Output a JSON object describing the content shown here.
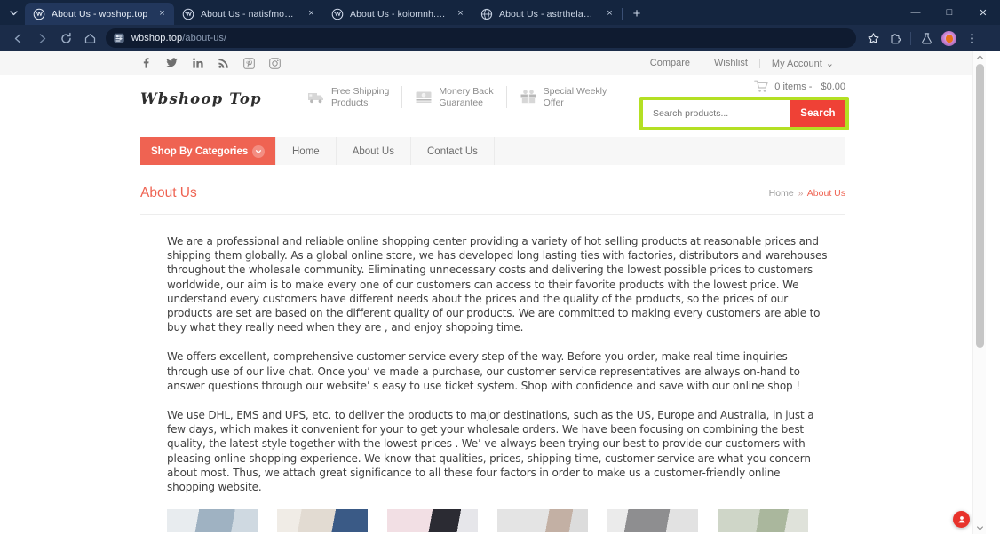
{
  "browser": {
    "tabs": [
      {
        "title": "About Us - wbshop.top",
        "favicon": "wordpress-icon",
        "active": true
      },
      {
        "title": "About Us - natisfmoneop.top",
        "favicon": "wordpress-icon",
        "active": false
      },
      {
        "title": "About Us - koiomnh.top",
        "favicon": "wordpress-icon",
        "active": false
      },
      {
        "title": "About Us - astrthelab.shop",
        "favicon": "globe-icon",
        "active": false
      }
    ],
    "tab_close_label": "×",
    "new_tab_label": "+",
    "tab_search_name": "tab-search-chevron-icon",
    "window_controls": {
      "minimize": "—",
      "maximize": "□",
      "close": "✕"
    },
    "nav": {
      "back": "←",
      "forward": "→",
      "reload": "⟳",
      "home": "⌂"
    },
    "omnibox": {
      "url_host": "wbshop.top",
      "url_path": "/about-us/",
      "site_icon": "page-settings-icon"
    },
    "toolbar_icons": [
      "bookmark-star-icon",
      "extensions-puzzle-icon",
      "labs-flask-icon",
      "profile-avatar",
      "chrome-menu-icon"
    ]
  },
  "site": {
    "socials": [
      {
        "name": "facebook-icon",
        "glyph": "f"
      },
      {
        "name": "twitter-icon",
        "glyph": "🐦"
      },
      {
        "name": "linkedin-icon",
        "glyph": "in"
      },
      {
        "name": "rss-icon",
        "glyph": "◔"
      },
      {
        "name": "pinterest-icon",
        "glyph": "ⓟ"
      },
      {
        "name": "instagram-icon",
        "glyph": "▣"
      }
    ],
    "util_links": [
      "Compare",
      "Wishlist",
      "My Account"
    ],
    "my_account_caret": "⌄",
    "logo": "Wbshoop Top",
    "features": [
      {
        "icon": "delivery-truck-icon",
        "line1": "Free Shipping",
        "line2": "Products"
      },
      {
        "icon": "money-back-icon",
        "line1": "Monery Back",
        "line2": "Guarantee"
      },
      {
        "icon": "gift-offer-icon",
        "line1": "Special Weekly",
        "line2": "Offer"
      }
    ],
    "cart": {
      "icon": "shopping-cart-icon",
      "items_text": "0 items -",
      "total": "$0.00"
    },
    "search": {
      "placeholder": "Search products...",
      "value": "",
      "button_label": "Search",
      "highlight_color": "#b4e023"
    },
    "nav": {
      "categories_label": "Shop By Categories",
      "categories_caret": "❯",
      "links": [
        "Home",
        "About Us",
        "Contact Us"
      ]
    },
    "page_title": "About Us",
    "breadcrumb": {
      "home": "Home",
      "separator": "»",
      "current": "About Us"
    },
    "paragraphs": [
      "We are a professional and reliable online shopping center providing a variety of hot selling products at reasonable prices and shipping them globally. As a global online store, we has developed long lasting ties with factories, distributors and warehouses throughout the wholesale community. Eliminating unnecessary costs and delivering the lowest possible prices to customers worldwide, our aim is to make every one of our customers can access to their favorite products with the lowest price. We understand every customers have different needs about the prices and the quality of the products, so the prices of our products are set are based on the different quality of our products. We are committed to making every customers are able to buy what they really need when they are , and enjoy shopping time.",
      "We offers excellent, comprehensive customer service every step of the way. Before you order, make real time inquiries through use of our live chat. Once you’ ve made a purchase, our customer service representatives are always on-hand to answer questions through our website’ s easy to use ticket system. Shop with confidence and save with  our online shop !",
      "We use DHL, EMS and UPS, etc. to deliver the products to major destinations, such as the US, Europe and Australia, in just a few days, which makes it convenient for your to get your wholesale orders. We have been focusing on combining the best quality, the latest style together with the lowest prices . We’ ve always been trying our best to provide our customers with pleasing online shopping experience. We know that qualities, prices, shipping time, customer service are what you concern about most. Thus, we attach great significance to all these four factors in order to make us a customer-friendly online shopping website."
    ],
    "product_thumbs": [
      {
        "name": "product-thumb-1",
        "color_a": "#e8ecef",
        "color_b": "#8fa3b4"
      },
      {
        "name": "product-thumb-2",
        "color_a": "#efe9e2",
        "color_b": "#3a5a86"
      },
      {
        "name": "product-thumb-3",
        "color_a": "#f2dfe4",
        "color_b": "#2b2b33"
      },
      {
        "name": "product-thumb-4",
        "color_a": "#e4e4e4",
        "color_b": "#b9a79c"
      },
      {
        "name": "product-thumb-5",
        "color_a": "#e9e9e9",
        "color_b": "#8e8e90"
      },
      {
        "name": "product-thumb-6",
        "color_a": "#cfd6c8",
        "color_b": "#9aa594"
      }
    ],
    "float_badge": {
      "name": "download-person-badge",
      "color": "#e8322b"
    }
  }
}
